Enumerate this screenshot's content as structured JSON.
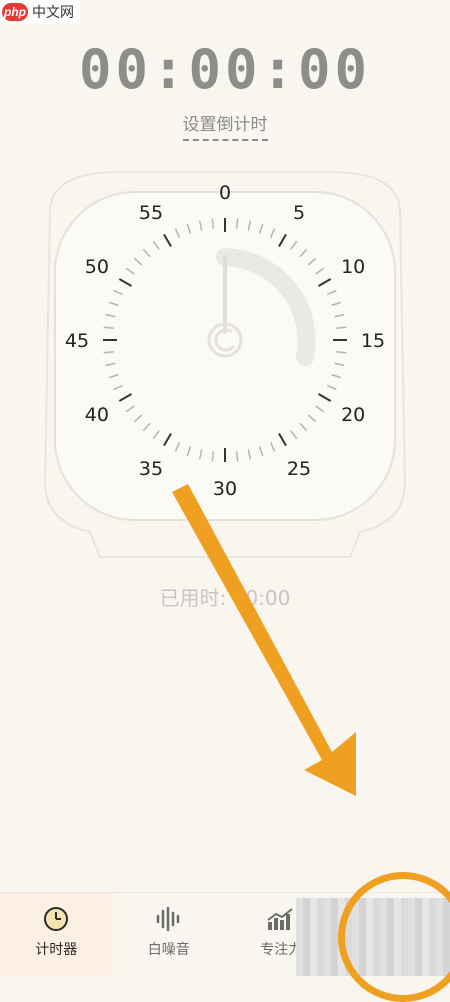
{
  "watermark": {
    "logo": "php",
    "text": "中文网"
  },
  "timer": {
    "display": "00:00:00",
    "set_label": "设置倒计时",
    "used_label": "已用时: 00:00"
  },
  "dial": {
    "numbers": [
      "0",
      "5",
      "10",
      "15",
      "20",
      "25",
      "30",
      "35",
      "40",
      "45",
      "50",
      "55"
    ]
  },
  "tabs": [
    {
      "label": "计时器",
      "icon": "clock-icon",
      "active": true
    },
    {
      "label": "白噪音",
      "icon": "sound-wave-icon",
      "active": false
    },
    {
      "label": "专注力",
      "icon": "chart-icon",
      "active": false
    },
    {
      "label": "",
      "icon": "more-icon",
      "active": false
    }
  ],
  "colors": {
    "accent_orange": "#f0a020",
    "background": "#f8f6ef"
  }
}
